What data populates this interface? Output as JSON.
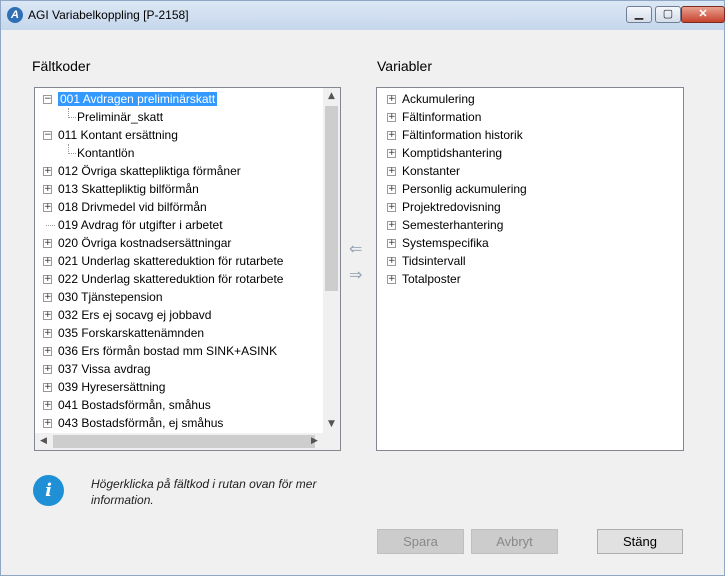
{
  "window": {
    "title": "AGI Variabelkoppling [P-2158]",
    "app_icon": "A"
  },
  "title_buttons": {
    "minimize": "▁",
    "maximize": "▢",
    "close": "✕"
  },
  "left_panel": {
    "label": "Fältkoder",
    "items": [
      {
        "text": "001 Avdragen preliminärskatt",
        "type": "expanded",
        "selected": true
      },
      {
        "text": "Preliminär_skatt",
        "type": "child"
      },
      {
        "text": "011 Kontant ersättning",
        "type": "expanded"
      },
      {
        "text": "Kontantlön",
        "type": "child"
      },
      {
        "text": "012 Övriga skattepliktiga förmåner",
        "type": "collapsed"
      },
      {
        "text": "013 Skattepliktig bilförmån",
        "type": "collapsed"
      },
      {
        "text": "018 Drivmedel vid bilförmån",
        "type": "collapsed"
      },
      {
        "text": "019 Avdrag för utgifter i arbetet",
        "type": "leaf"
      },
      {
        "text": "020 Övriga kostnadsersättningar",
        "type": "collapsed"
      },
      {
        "text": "021 Underlag skattereduktion för rutarbete",
        "type": "collapsed"
      },
      {
        "text": "022 Underlag skattereduktion för rotarbete",
        "type": "collapsed"
      },
      {
        "text": "030 Tjänstepension",
        "type": "collapsed"
      },
      {
        "text": "032 Ers ej socavg ej jobbavd",
        "type": "collapsed"
      },
      {
        "text": "035 Forskarskattenämnden",
        "type": "collapsed"
      },
      {
        "text": "036 Ers förmån bostad mm SINK+ASINK",
        "type": "collapsed"
      },
      {
        "text": "037 Vissa avdrag",
        "type": "collapsed"
      },
      {
        "text": "039 Hyresersättning",
        "type": "collapsed"
      },
      {
        "text": "041 Bostadsförmån, småhus",
        "type": "collapsed"
      },
      {
        "text": "043 Bostadsförmån, ej småhus",
        "type": "collapsed"
      }
    ]
  },
  "right_panel": {
    "label": "Variabler",
    "items": [
      "Ackumulering",
      "Fältinformation",
      "Fältinformation historik",
      "Komptidshantering",
      "Konstanter",
      "Personlig ackumulering",
      "Projektredovisning",
      "Semesterhantering",
      "Systemspecifika",
      "Tidsintervall",
      "Totalposter"
    ]
  },
  "info": {
    "icon": "i",
    "text": "Högerklicka på fältkod i rutan ovan för mer information."
  },
  "buttons": {
    "save": "Spara",
    "cancel": "Avbryt",
    "close": "Stäng"
  },
  "colors": {
    "selection": "#3399ff",
    "info_icon": "#1f8fd6"
  }
}
